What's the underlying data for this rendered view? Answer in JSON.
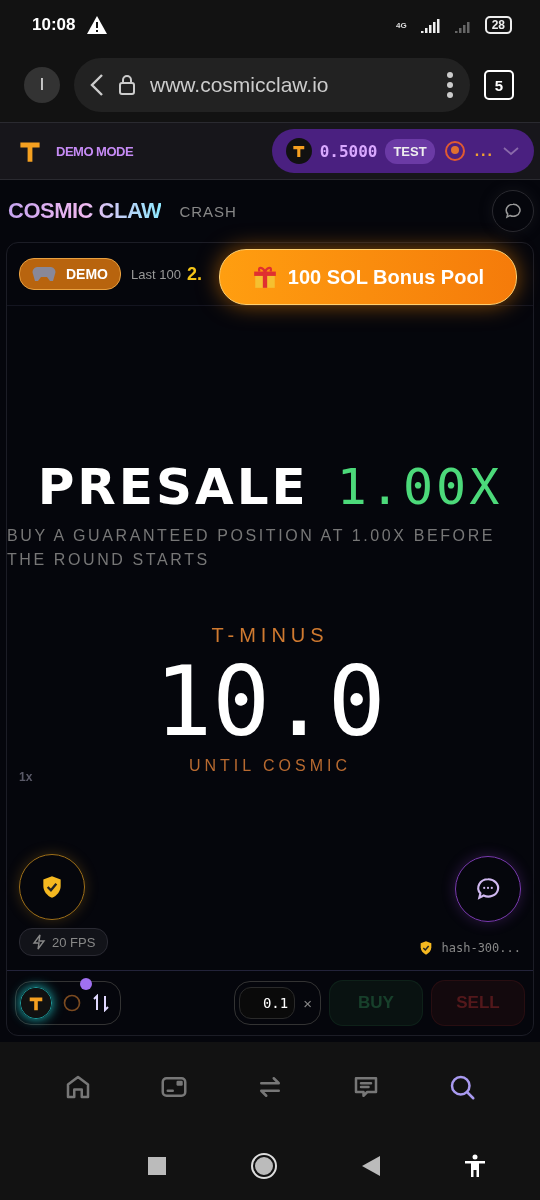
{
  "status_bar": {
    "time": "10:08",
    "network": "4G",
    "battery": "28"
  },
  "browser": {
    "profile": "I",
    "url": "www.cosmicclaw.io",
    "tabs_count": "5"
  },
  "app_header": {
    "mode": "DEMO MODE",
    "balance": "0.5000",
    "balance_tag": "TEST",
    "account": "..."
  },
  "game_title": {
    "brand": "COSMIC CLAW",
    "subtitle": "CRASH"
  },
  "ticker": {
    "demo_label": "DEMO",
    "history_label": "Last 100",
    "last_multiplier": "2.",
    "bonus": "100 SOL Bonus Pool"
  },
  "stage": {
    "axis_label": "1x",
    "headline": "PRESALE",
    "multiplier": "1.00X",
    "description": "BUY A GUARANTEED POSITION AT 1.00X BEFORE THE ROUND STARTS",
    "countdown_label": "T-MINUS",
    "countdown": "10.0",
    "countdown_caption": "UNTIL COSMIC",
    "fps": "20 FPS",
    "hash": "hash-300..."
  },
  "trade_bar": {
    "amount": "0.1",
    "clear": "×",
    "buy": "BUY",
    "sell": "SELL",
    "buy_disabled": true,
    "sell_disabled": true
  },
  "bottom_nav": [
    {
      "kind": "home",
      "selected": false
    },
    {
      "kind": "wallet",
      "selected": false
    },
    {
      "kind": "swap",
      "selected": false
    },
    {
      "kind": "chat",
      "selected": false
    },
    {
      "kind": "search",
      "selected": true
    }
  ]
}
